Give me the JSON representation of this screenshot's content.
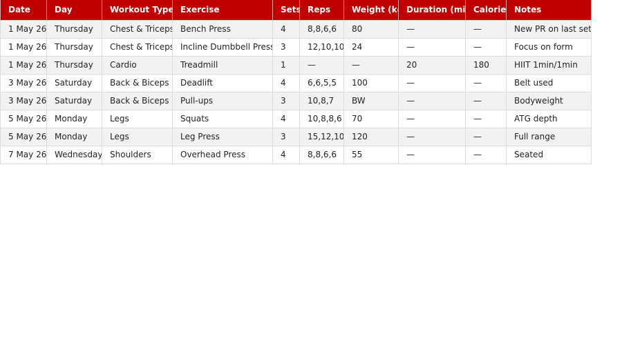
{
  "table": {
    "headers": [
      "Date",
      "Day",
      "Workout Type",
      "Exercise",
      "Sets",
      "Reps",
      "Weight (kg)",
      "Duration (min)",
      "Calories",
      "Notes"
    ],
    "rows": [
      [
        "1 May 26",
        "Thursday",
        "Chest & Triceps",
        "Bench Press",
        "4",
        "8,8,6,6",
        "80",
        "—",
        "—",
        "New PR on last set!"
      ],
      [
        "1 May 26",
        "Thursday",
        "Chest & Triceps",
        "Incline Dumbbell Press",
        "3",
        "12,10,10",
        "24",
        "—",
        "—",
        "Focus on form"
      ],
      [
        "1 May 26",
        "Thursday",
        "Cardio",
        "Treadmill",
        "1",
        "—",
        "—",
        "20",
        "180",
        "HIIT 1min/1min"
      ],
      [
        "3 May 26",
        "Saturday",
        "Back & Biceps",
        "Deadlift",
        "4",
        "6,6,5,5",
        "100",
        "—",
        "—",
        "Belt used"
      ],
      [
        "3 May 26",
        "Saturday",
        "Back & Biceps",
        "Pull-ups",
        "3",
        "10,8,7",
        "BW",
        "—",
        "—",
        "Bodyweight"
      ],
      [
        "5 May 26",
        "Monday",
        "Legs",
        "Squats",
        "4",
        "10,8,8,6",
        "70",
        "—",
        "—",
        "ATG depth"
      ],
      [
        "5 May 26",
        "Monday",
        "Legs",
        "Leg Press",
        "3",
        "15,12,10",
        "120",
        "—",
        "—",
        "Full range"
      ],
      [
        "7 May 26",
        "Wednesday",
        "Shoulders",
        "Overhead Press",
        "4",
        "8,8,6,6",
        "55",
        "—",
        "—",
        "Seated"
      ]
    ]
  },
  "colors": {
    "header_bg": "#c00000",
    "header_text": "#ffffff",
    "row_alt_bg": "#f2f2f2"
  }
}
